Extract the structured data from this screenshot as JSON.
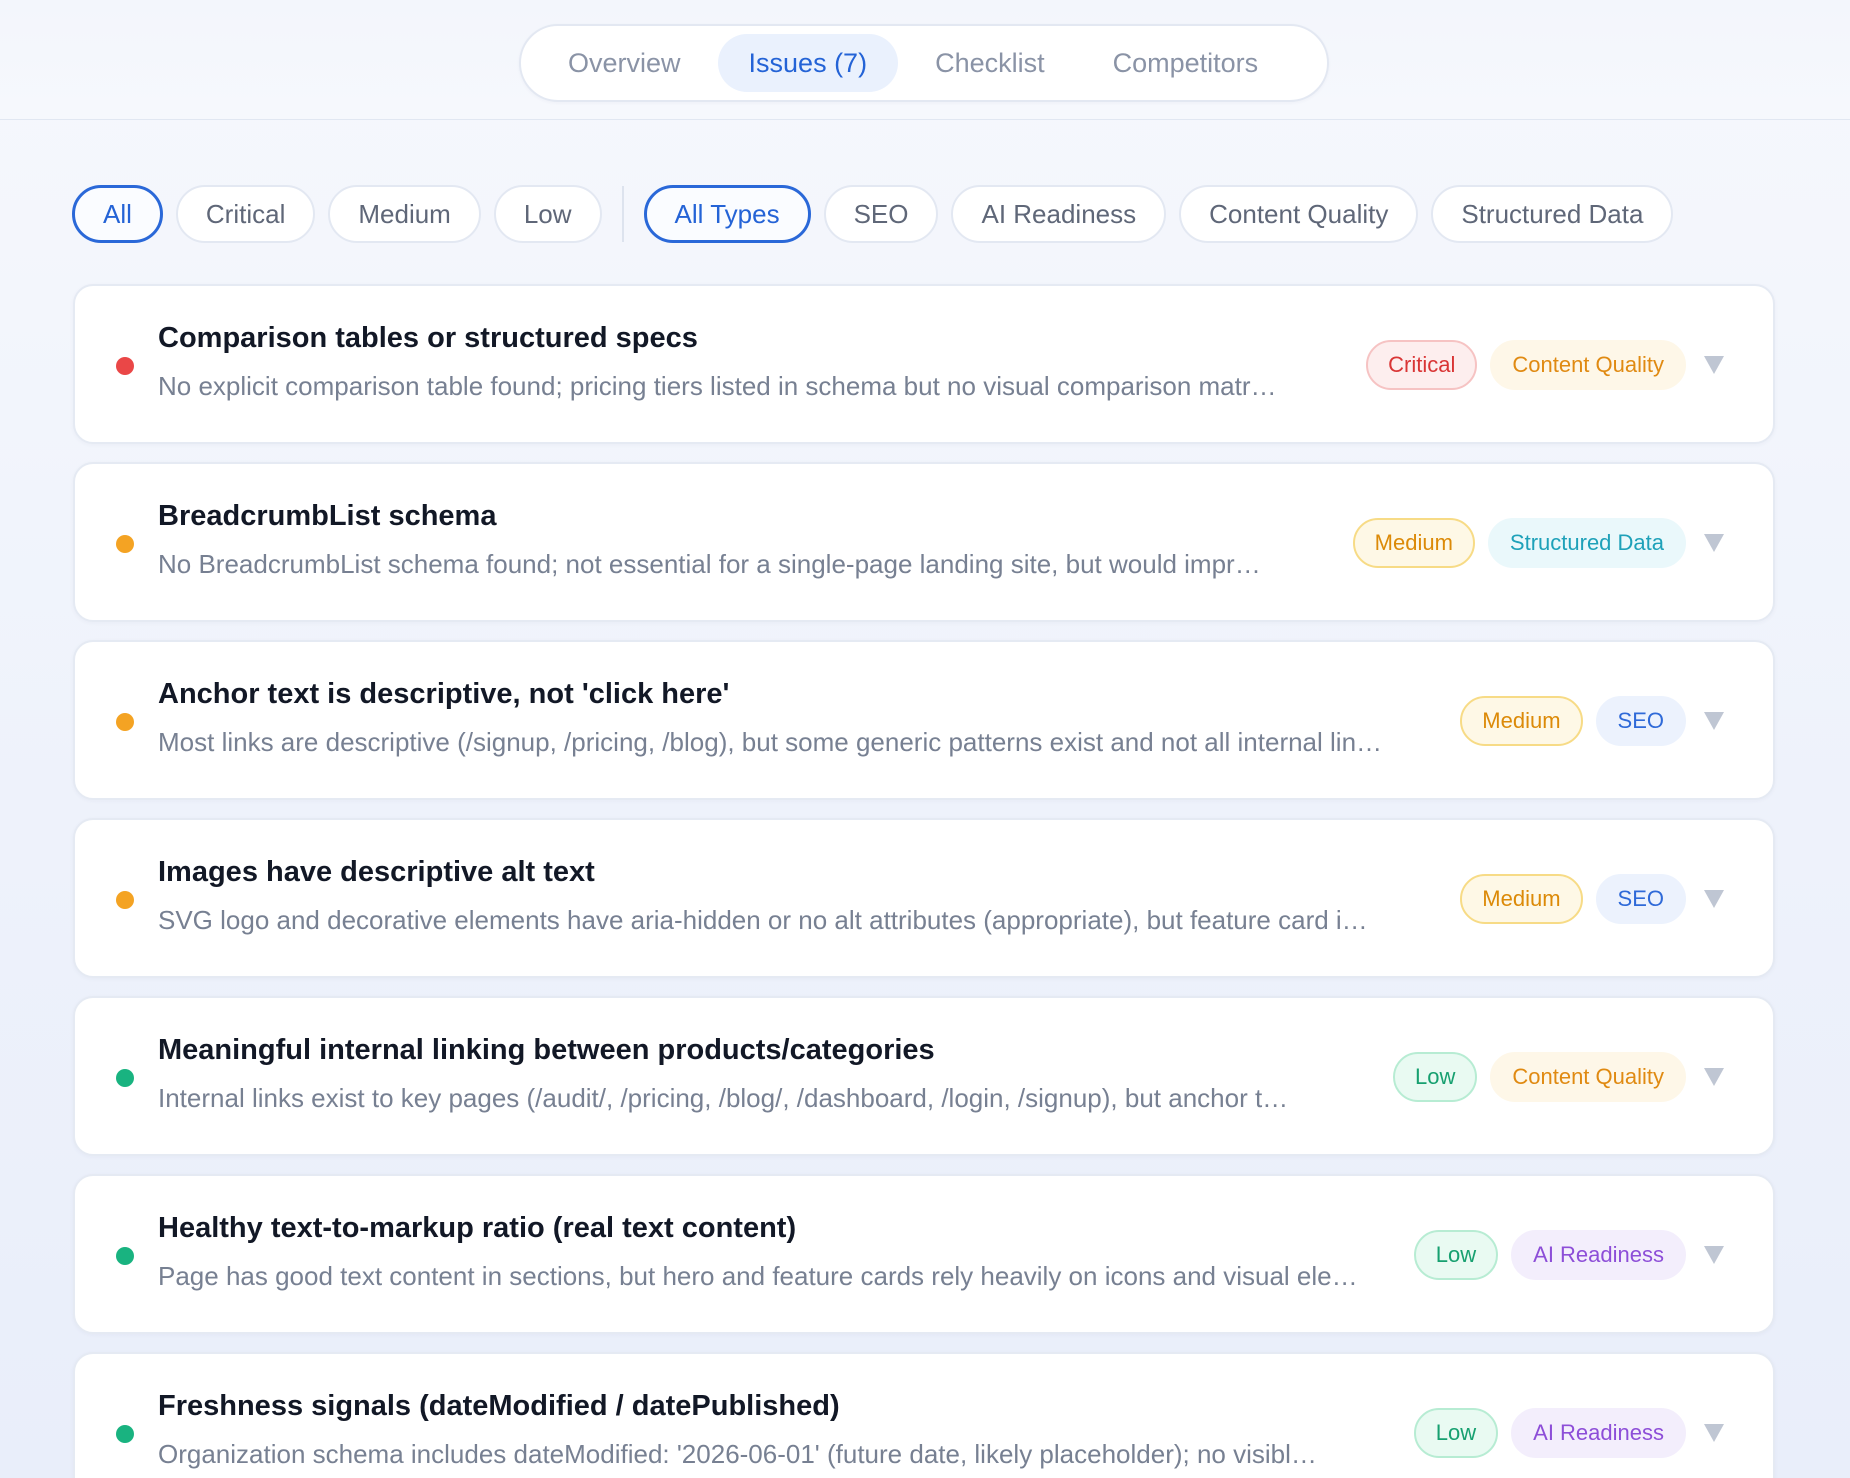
{
  "tabs": [
    {
      "label": "Overview",
      "active": false
    },
    {
      "label": "Issues (7)",
      "active": true
    },
    {
      "label": "Checklist",
      "active": false
    },
    {
      "label": "Competitors",
      "active": false
    }
  ],
  "severity_filters": [
    {
      "label": "All",
      "active": true
    },
    {
      "label": "Critical",
      "active": false
    },
    {
      "label": "Medium",
      "active": false
    },
    {
      "label": "Low",
      "active": false
    }
  ],
  "type_filters": [
    {
      "label": "All Types",
      "active": true
    },
    {
      "label": "SEO",
      "active": false
    },
    {
      "label": "AI Readiness",
      "active": false
    },
    {
      "label": "Content Quality",
      "active": false
    },
    {
      "label": "Structured Data",
      "active": false
    }
  ],
  "colors": {
    "accent": "#2463d6",
    "critical": "#ea4747",
    "medium": "#f4a323",
    "low": "#19b380"
  },
  "icons": {
    "expand": "chevron-down-icon"
  },
  "issues": [
    {
      "title": "Comparison tables or structured specs",
      "description": "No explicit comparison table found; pricing tiers listed in schema but no visual comparison matr…",
      "severity": "Critical",
      "category": "Content Quality"
    },
    {
      "title": "BreadcrumbList schema",
      "description": "No BreadcrumbList schema found; not essential for a single-page landing site, but would impr…",
      "severity": "Medium",
      "category": "Structured Data"
    },
    {
      "title": "Anchor text is descriptive, not 'click here'",
      "description": "Most links are descriptive (/signup, /pricing, /blog), but some generic patterns exist and not all internal lin…",
      "severity": "Medium",
      "category": "SEO"
    },
    {
      "title": "Images have descriptive alt text",
      "description": "SVG logo and decorative elements have aria-hidden or no alt attributes (appropriate), but feature card i…",
      "severity": "Medium",
      "category": "SEO"
    },
    {
      "title": "Meaningful internal linking between products/categories",
      "description": "Internal links exist to key pages (/audit/, /pricing, /blog/, /dashboard, /login, /signup), but anchor t…",
      "severity": "Low",
      "category": "Content Quality"
    },
    {
      "title": "Healthy text-to-markup ratio (real text content)",
      "description": "Page has good text content in sections, but hero and feature cards rely heavily on icons and visual ele…",
      "severity": "Low",
      "category": "AI Readiness"
    },
    {
      "title": "Freshness signals (dateModified / datePublished)",
      "description": "Organization schema includes dateModified: '2026-06-01' (future date, likely placeholder); no visibl…",
      "severity": "Low",
      "category": "AI Readiness"
    }
  ]
}
